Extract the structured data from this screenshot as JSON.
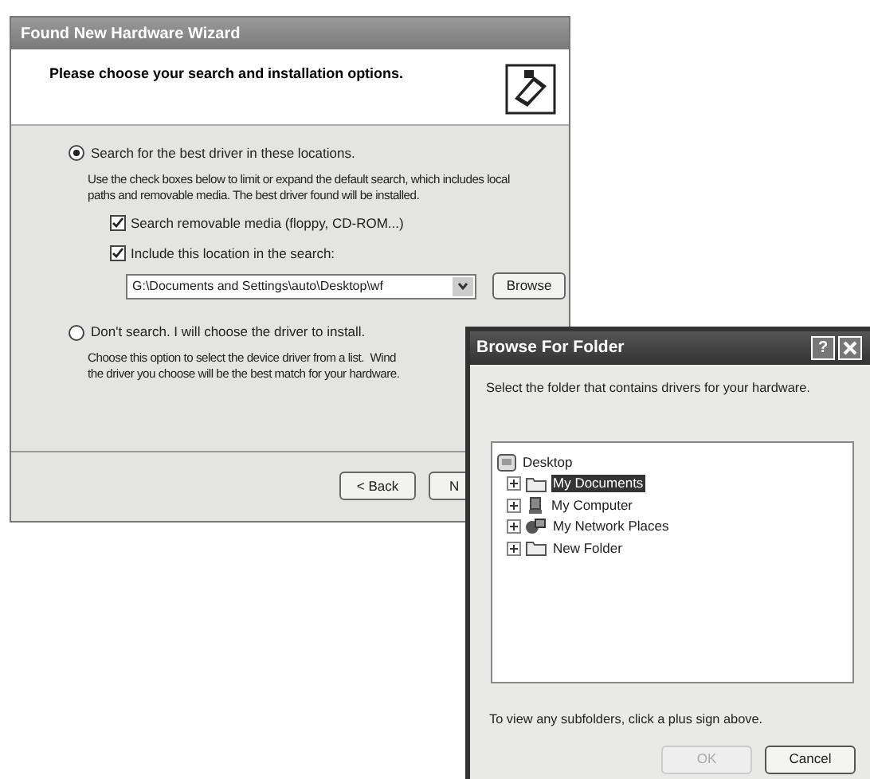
{
  "wizard": {
    "title": "Found New Hardware Wizard",
    "heading": "Please choose your search and installation options.",
    "options": [
      {
        "label": "Search for the best driver in these locations.",
        "selected": true,
        "description": [
          "Use the check boxes below to limit or expand the default search, which includes local",
          "paths and removable media. The best driver found will be installed."
        ]
      },
      {
        "label": "Don't search. I will choose the driver to install.",
        "selected": false,
        "description": [
          "Choose this option to select the device driver from a list.  Wind",
          "the driver you choose will be the best match for your hardware."
        ]
      }
    ],
    "checkboxes": [
      {
        "label": "Search removable media (floppy, CD-ROM...)",
        "checked": true
      },
      {
        "label": "Include this location in the search:",
        "checked": true
      }
    ],
    "location": {
      "value": "G:\\Documents and Settings\\auto\\Desktop\\wf"
    },
    "browse_button": "Browse",
    "buttons": [
      "< Back",
      "N"
    ]
  },
  "browse_dialog": {
    "title": "Browse For Folder",
    "help_button": "?",
    "instruction": "Select the folder that contains drivers for your hardware.",
    "tree": [
      {
        "label": "Desktop",
        "kind": "desktop",
        "selected": false,
        "children": [
          {
            "label": "My Documents",
            "kind": "folder",
            "selected": true
          },
          {
            "label": "My Computer",
            "kind": "computer",
            "selected": false
          },
          {
            "label": "My Network Places",
            "kind": "network",
            "selected": false
          },
          {
            "label": "New Folder",
            "kind": "folder",
            "selected": false
          }
        ]
      }
    ],
    "hint": "To view any subfolders, click a plus sign above.",
    "buttons": [
      {
        "label": "OK",
        "disabled": true
      },
      {
        "label": "Cancel",
        "disabled": false
      }
    ]
  }
}
